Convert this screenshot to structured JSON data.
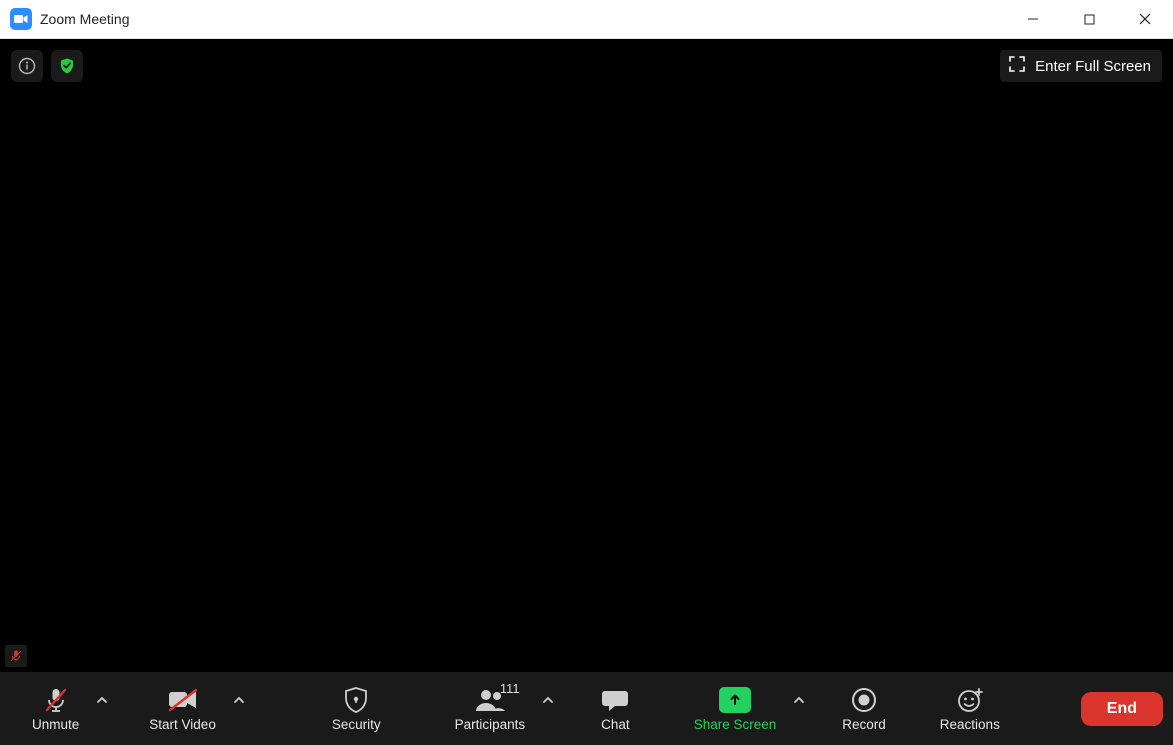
{
  "title": "Zoom Meeting",
  "fullscreen_label": "Enter Full Screen",
  "participants_count": "111",
  "toolbar": {
    "unmute": "Unmute",
    "start_video": "Start Video",
    "security": "Security",
    "participants": "Participants",
    "chat": "Chat",
    "share_screen": "Share Screen",
    "record": "Record",
    "reactions": "Reactions",
    "end": "End"
  },
  "colors": {
    "accent_green": "#23d160",
    "end_red": "#d9352c",
    "zoom_blue": "#2d8cff"
  }
}
